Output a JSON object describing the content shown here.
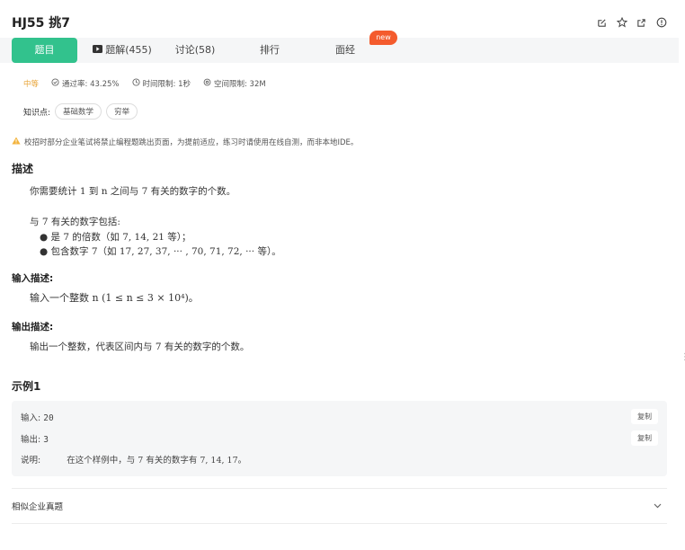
{
  "header": {
    "title": "HJ55  挑7"
  },
  "tabs": {
    "t1": "题目",
    "t2": "题解(455)",
    "t3": "讨论(58)",
    "t4": "排行",
    "t5": "面经",
    "badge": "new"
  },
  "meta": {
    "difficulty": "中等",
    "pass_rate": "通过率: 43.25%",
    "time_limit": "时间限制: 1秒",
    "space_limit": "空间限制: 32M"
  },
  "knowledge": {
    "label": "知识点:",
    "tag1": "基础数学",
    "tag2": "穷举"
  },
  "warning": "校招时部分企业笔试将禁止编程题跳出页面，为提前适应，练习时请使用在线自测，而非本地IDE。",
  "description": {
    "heading": "描述",
    "line1": "你需要统计 1 到 n 之间与 7 有关的数字的个数。",
    "line2": "与 7 有关的数字包括:",
    "bullet1": "是 7 的倍数（如 7, 14, 21 等）；",
    "bullet2": "包含数字 7（如 17, 27, 37, ··· , 70, 71, 72, ··· 等）。"
  },
  "input_desc": {
    "heading": "输入描述:",
    "text": "输入一个整数 n (1 ≤ n ≤ 3 × 10⁴)。"
  },
  "output_desc": {
    "heading": "输出描述:",
    "text": "输出一个整数，代表区间内与 7 有关的数字的个数。"
  },
  "example": {
    "heading": "示例1",
    "input_label": "输入:",
    "input_value": "20",
    "output_label": "输出:",
    "output_value": "3",
    "explain_label": "说明:",
    "explain_text": "在这个样例中，与 7 有关的数字有 7, 14, 17。",
    "copy": "复制"
  },
  "similar": "相似企业真题"
}
